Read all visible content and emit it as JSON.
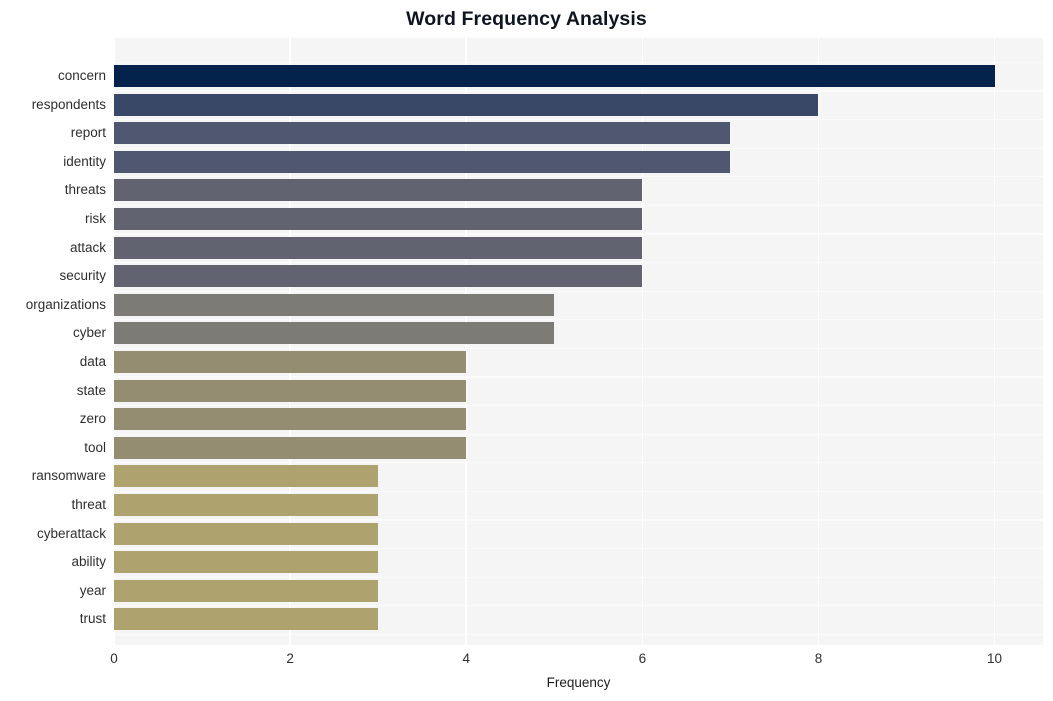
{
  "chart_data": {
    "type": "bar",
    "orientation": "horizontal",
    "title": "Word Frequency Analysis",
    "xlabel": "Frequency",
    "ylabel": "",
    "xlim": [
      0,
      10.55
    ],
    "xticks": [
      0,
      2,
      4,
      6,
      8,
      10
    ],
    "xticklabels": [
      "0",
      "2",
      "4",
      "6",
      "8",
      "10"
    ],
    "grid": true,
    "grid_color": "#ffffff",
    "plot_background": "#f5f5f6",
    "figure_background": "#ffffff",
    "legend": null,
    "categories": [
      "concern",
      "respondents",
      "report",
      "identity",
      "threats",
      "risk",
      "attack",
      "security",
      "organizations",
      "cyber",
      "data",
      "state",
      "zero",
      "tool",
      "ransomware",
      "threat",
      "cyberattack",
      "ability",
      "year",
      "trust"
    ],
    "values": [
      10,
      8,
      7,
      7,
      6,
      6,
      6,
      6,
      5,
      5,
      4,
      4,
      4,
      4,
      3,
      3,
      3,
      3,
      3,
      3
    ],
    "bar_colors": [
      "#03224c",
      "#394866",
      "#4f5771",
      "#4f5771",
      "#616470",
      "#616470",
      "#616470",
      "#616470",
      "#7c7b76",
      "#7c7b76",
      "#948d72",
      "#948d72",
      "#948d72",
      "#948d72",
      "#aea26f",
      "#aea26f",
      "#aea26f",
      "#aea26f",
      "#aea26f",
      "#aea26f"
    ],
    "bars": [
      {
        "label": "concern",
        "value": 10,
        "color": "#03224c"
      },
      {
        "label": "respondents",
        "value": 8,
        "color": "#394866"
      },
      {
        "label": "report",
        "value": 7,
        "color": "#4f5771"
      },
      {
        "label": "identity",
        "value": 7,
        "color": "#4f5771"
      },
      {
        "label": "threats",
        "value": 6,
        "color": "#616470"
      },
      {
        "label": "risk",
        "value": 6,
        "color": "#616470"
      },
      {
        "label": "attack",
        "value": 6,
        "color": "#616470"
      },
      {
        "label": "security",
        "value": 6,
        "color": "#616470"
      },
      {
        "label": "organizations",
        "value": 5,
        "color": "#7c7b76"
      },
      {
        "label": "cyber",
        "value": 5,
        "color": "#7c7b76"
      },
      {
        "label": "data",
        "value": 4,
        "color": "#948d72"
      },
      {
        "label": "state",
        "value": 4,
        "color": "#948d72"
      },
      {
        "label": "zero",
        "value": 4,
        "color": "#948d72"
      },
      {
        "label": "tool",
        "value": 4,
        "color": "#948d72"
      },
      {
        "label": "ransomware",
        "value": 3,
        "color": "#aea26f"
      },
      {
        "label": "threat",
        "value": 3,
        "color": "#aea26f"
      },
      {
        "label": "cyberattack",
        "value": 3,
        "color": "#aea26f"
      },
      {
        "label": "ability",
        "value": 3,
        "color": "#aea26f"
      },
      {
        "label": "year",
        "value": 3,
        "color": "#aea26f"
      },
      {
        "label": "trust",
        "value": 3,
        "color": "#aea26f"
      }
    ]
  }
}
